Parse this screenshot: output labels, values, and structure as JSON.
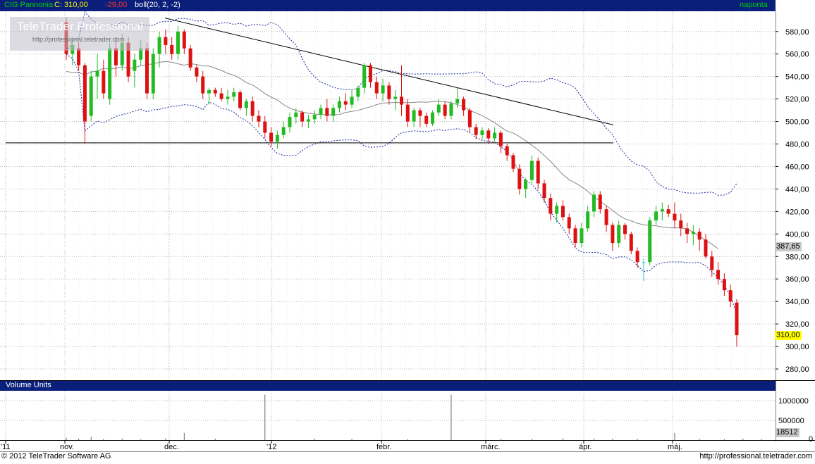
{
  "header": {
    "instrument": "CIG Pannonia",
    "close_label": "C: 310,00",
    "change": "-29,00",
    "indicator": "boll(20, 2, -2)",
    "period": "naponta"
  },
  "logo": {
    "name": "TeleTrader Professional",
    "url": "http://professional.teletrader.com"
  },
  "volume_panel": {
    "title": "Volume Units",
    "last_value": "18512"
  },
  "footer": {
    "copyright": "© 2012 TeleTrader Software AG",
    "url": "http://professional.teletrader.com"
  },
  "colors": {
    "up": "#22bb22",
    "down": "#dd1111",
    "neutral": "#22ccee",
    "header_bg": "#0a1f7a",
    "band": "#1a2aa0",
    "ma": "#888888",
    "price_tag": "#ffff00"
  },
  "chart_data": [
    {
      "type": "candlestick",
      "title": "CIG Pannonia",
      "ylim": [
        270,
        598
      ],
      "yticks": [
        280,
        300,
        320,
        340,
        360,
        380,
        400,
        420,
        440,
        460,
        480,
        500,
        520,
        540,
        560,
        580
      ],
      "ytick_labels": [
        "280,00",
        "300,00",
        "320,00",
        "340,00",
        "360,00",
        "380,00",
        "400,00",
        "420,00",
        "440,00",
        "460,00",
        "480,00",
        "500,00",
        "520,00",
        "540,00",
        "560,00",
        "580,00"
      ],
      "xtick_labels": [
        "'11",
        "nov.",
        "dec.",
        "'12",
        "febr.",
        "márc.",
        "ápr.",
        "máj."
      ],
      "last_price_label": "310,00",
      "band_label": "387,65",
      "grid": true,
      "ohlc": [
        [
          588,
          592,
          555,
          560
        ],
        [
          560,
          575,
          550,
          568
        ],
        [
          565,
          570,
          545,
          550
        ],
        [
          550,
          552,
          480,
          500
        ],
        [
          505,
          545,
          500,
          540
        ],
        [
          540,
          560,
          520,
          545
        ],
        [
          545,
          555,
          520,
          525
        ],
        [
          520,
          570,
          515,
          565
        ],
        [
          565,
          575,
          540,
          550
        ],
        [
          550,
          578,
          545,
          570
        ],
        [
          570,
          575,
          535,
          540
        ],
        [
          545,
          560,
          530,
          555
        ],
        [
          555,
          572,
          550,
          565
        ],
        [
          565,
          570,
          520,
          525
        ],
        [
          525,
          565,
          520,
          560
        ],
        [
          560,
          580,
          548,
          575
        ],
        [
          575,
          582,
          560,
          568
        ],
        [
          568,
          575,
          555,
          560
        ],
        [
          560,
          585,
          555,
          580
        ],
        [
          580,
          582,
          560,
          565
        ],
        [
          565,
          568,
          545,
          548
        ],
        [
          548,
          550,
          535,
          540
        ],
        [
          540,
          545,
          520,
          525
        ],
        [
          525,
          530,
          515,
          528
        ],
        [
          528,
          530,
          522,
          525
        ],
        [
          525,
          530,
          518,
          520
        ],
        [
          520,
          528,
          515,
          522
        ],
        [
          522,
          530,
          518,
          526
        ],
        [
          526,
          528,
          510,
          512
        ],
        [
          512,
          520,
          505,
          518
        ],
        [
          518,
          522,
          500,
          505
        ],
        [
          505,
          510,
          495,
          500
        ],
        [
          500,
          505,
          485,
          490
        ],
        [
          490,
          495,
          478,
          482
        ],
        [
          482,
          492,
          476,
          488
        ],
        [
          488,
          500,
          485,
          495
        ],
        [
          495,
          508,
          490,
          504
        ],
        [
          504,
          512,
          498,
          508
        ],
        [
          508,
          510,
          495,
          500
        ],
        [
          500,
          506,
          494,
          502
        ],
        [
          502,
          510,
          498,
          506
        ],
        [
          506,
          515,
          502,
          512
        ],
        [
          512,
          520,
          500,
          505
        ],
        [
          505,
          515,
          500,
          512
        ],
        [
          512,
          522,
          508,
          518
        ],
        [
          518,
          525,
          510,
          515
        ],
        [
          515,
          528,
          512,
          522
        ],
        [
          522,
          532,
          518,
          530
        ],
        [
          530,
          552,
          525,
          550
        ],
        [
          550,
          552,
          530,
          535
        ],
        [
          535,
          540,
          520,
          525
        ],
        [
          525,
          538,
          518,
          532
        ],
        [
          532,
          535,
          515,
          520
        ],
        [
          520,
          528,
          510,
          522
        ],
        [
          522,
          550,
          505,
          515
        ],
        [
          515,
          520,
          495,
          500
        ],
        [
          500,
          512,
          495,
          510
        ],
        [
          510,
          512,
          495,
          505
        ],
        [
          505,
          508,
          495,
          498
        ],
        [
          498,
          510,
          496,
          508
        ],
        [
          508,
          520,
          505,
          515
        ],
        [
          515,
          518,
          502,
          505
        ],
        [
          505,
          518,
          502,
          516
        ],
        [
          516,
          530,
          512,
          520
        ],
        [
          520,
          522,
          505,
          510
        ],
        [
          510,
          512,
          490,
          495
        ],
        [
          495,
          498,
          484,
          488
        ],
        [
          488,
          495,
          484,
          492
        ],
        [
          492,
          494,
          480,
          485
        ],
        [
          485,
          495,
          482,
          490
        ],
        [
          490,
          492,
          472,
          478
        ],
        [
          478,
          480,
          465,
          470
        ],
        [
          470,
          472,
          455,
          458
        ],
        [
          458,
          462,
          435,
          440
        ],
        [
          440,
          450,
          432,
          448
        ],
        [
          448,
          470,
          445,
          465
        ],
        [
          465,
          468,
          440,
          445
        ],
        [
          445,
          448,
          428,
          432
        ],
        [
          432,
          436,
          412,
          418
        ],
        [
          418,
          428,
          410,
          425
        ],
        [
          425,
          430,
          412,
          415
        ],
        [
          415,
          418,
          400,
          405
        ],
        [
          405,
          408,
          388,
          392
        ],
        [
          392,
          410,
          388,
          405
        ],
        [
          405,
          425,
          402,
          420
        ],
        [
          420,
          438,
          415,
          435
        ],
        [
          435,
          438,
          418,
          422
        ],
        [
          422,
          425,
          402,
          408
        ],
        [
          408,
          410,
          385,
          392
        ],
        [
          392,
          412,
          388,
          408
        ],
        [
          408,
          410,
          395,
          400
        ],
        [
          400,
          402,
          382,
          385
        ],
        [
          385,
          388,
          370,
          375
        ],
        [
          375,
          378,
          358,
          375
        ],
        [
          375,
          415,
          372,
          412
        ],
        [
          412,
          425,
          408,
          420
        ],
        [
          420,
          428,
          412,
          422
        ],
        [
          422,
          426,
          415,
          418
        ],
        [
          418,
          428,
          405,
          412
        ],
        [
          412,
          418,
          398,
          405
        ],
        [
          405,
          410,
          392,
          400
        ],
        [
          400,
          408,
          390,
          402
        ],
        [
          402,
          405,
          385,
          395
        ],
        [
          395,
          400,
          378,
          380
        ],
        [
          380,
          385,
          362,
          368
        ],
        [
          368,
          375,
          355,
          360
        ],
        [
          360,
          365,
          345,
          350
        ],
        [
          350,
          355,
          335,
          340
        ],
        [
          339,
          342,
          300,
          310
        ]
      ],
      "volume": [
        {
          "i": 0,
          "v": 60000
        },
        {
          "i": 2,
          "v": 35000
        },
        {
          "i": 4,
          "v": 80000
        },
        {
          "i": 6,
          "v": 25000
        },
        {
          "i": 9,
          "v": 40000
        },
        {
          "i": 12,
          "v": 20000
        },
        {
          "i": 16,
          "v": 45000
        },
        {
          "i": 19,
          "v": 180000
        },
        {
          "i": 24,
          "v": 30000
        },
        {
          "i": 32,
          "v": 1150000
        },
        {
          "i": 40,
          "v": 35000
        },
        {
          "i": 46,
          "v": 30000
        },
        {
          "i": 55,
          "v": 25000
        },
        {
          "i": 62,
          "v": 1150000
        },
        {
          "i": 70,
          "v": 30000
        },
        {
          "i": 75,
          "v": 35000
        },
        {
          "i": 80,
          "v": 45000
        },
        {
          "i": 85,
          "v": 40000
        },
        {
          "i": 88,
          "v": 35000
        },
        {
          "i": 92,
          "v": 30000
        },
        {
          "i": 98,
          "v": 180000
        },
        {
          "i": 102,
          "v": 30000
        },
        {
          "i": 106,
          "v": 25000
        },
        {
          "i": 109,
          "v": 40000
        },
        {
          "i": 112,
          "v": 30000
        },
        {
          "i": 116,
          "v": 60000
        },
        {
          "i": 120,
          "v": 35000
        },
        {
          "i": 124,
          "v": 30000
        },
        {
          "i": 127,
          "v": 25000
        }
      ],
      "volume_ylim": [
        0,
        1250000
      ],
      "volume_ticks": [
        "1000000",
        "500000",
        "0"
      ]
    }
  ]
}
